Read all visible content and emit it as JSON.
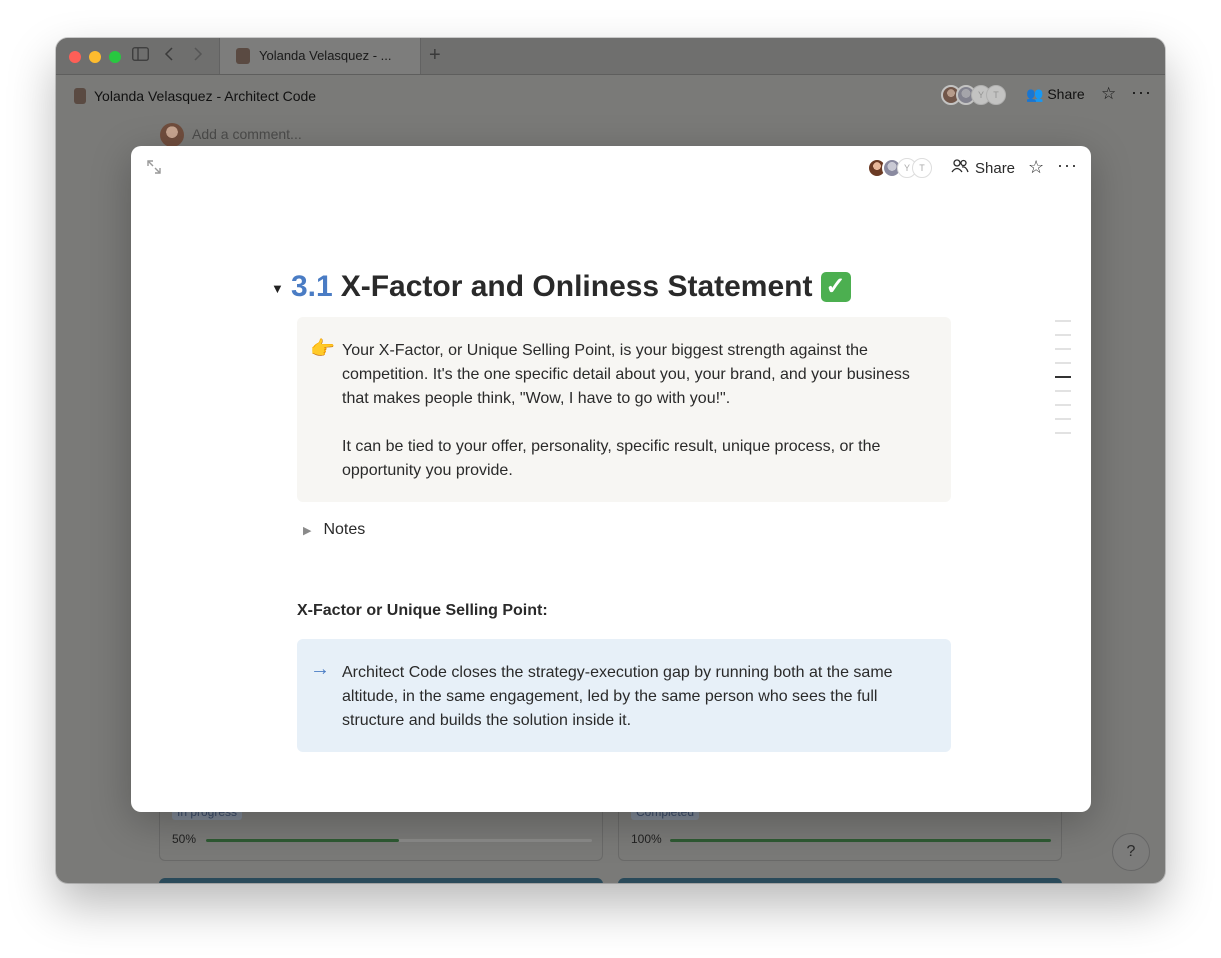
{
  "browser": {
    "tab_title": "Yolanda Velasquez - ...",
    "new_tab": "+"
  },
  "app_header": {
    "breadcrumb": "Yolanda Velasquez - Architect Code",
    "avatars": [
      "Y",
      "T"
    ],
    "share_label": "Share"
  },
  "background": {
    "comment_placeholder": "Add a comment...",
    "cards": [
      {
        "badge": "In progress",
        "progress_label": "50%",
        "progress": 0.5
      },
      {
        "badge": "Completed",
        "progress_label": "100%",
        "progress": 1.0
      }
    ],
    "help_label": "?"
  },
  "modal": {
    "avatars": [
      "Y",
      "T"
    ],
    "share_label": "Share",
    "heading": {
      "number": "3.1",
      "text": "X-Factor and Onliness Statement",
      "status_icon": "check-mark-button-icon"
    },
    "intro_callout": {
      "icon": "pointing-hand-icon",
      "paragraphs": [
        "Your X-Factor, or Unique Selling Point, is your biggest strength against the competition. It's the one specific detail about you, your brand, and your business that makes people think, \"Wow, I have to go with you!\".",
        "It can be tied to your offer, personality, specific result, unique process, or the opportunity you provide."
      ]
    },
    "notes_toggle": "Notes",
    "subheading": "X-Factor or Unique Selling Point:",
    "answer_callout": {
      "icon": "arrow-right-icon",
      "text": "Architect Code closes the strategy-execution gap by running both at the same altitude, in the same engagement, led by the same person who sees the full structure and builds the solution inside it."
    },
    "toc_active_index": 4
  }
}
